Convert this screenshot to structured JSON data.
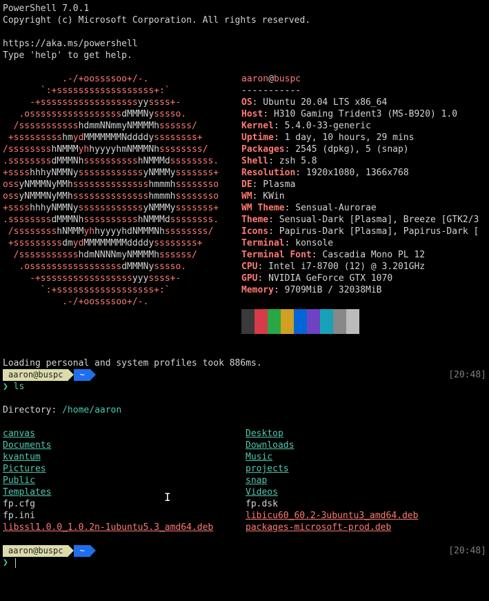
{
  "header": {
    "line1": "PowerShell 7.0.1",
    "line2": "Copyright (c) Microsoft Corporation. All rights reserved.",
    "link": "https://aka.ms/powershell",
    "help": "Type 'help' to get help."
  },
  "neo": {
    "user": "aaron",
    "at": "@",
    "host": "buspc",
    "sep": "-----------",
    "info": [
      {
        "k": "OS",
        "v": ": Ubuntu 20.04 LTS x86_64"
      },
      {
        "k": "Host",
        "v": ": H310 Gaming Trident3 (MS-B920) 1.0"
      },
      {
        "k": "Kernel",
        "v": ": 5.4.0-33-generic"
      },
      {
        "k": "Uptime",
        "v": ": 1 day, 10 hours, 29 mins"
      },
      {
        "k": "Packages",
        "v": ": 2545 (dpkg), 5 (snap)"
      },
      {
        "k": "Shell",
        "v": ": zsh 5.8"
      },
      {
        "k": "Resolution",
        "v": ": 1920x1080, 1366x768"
      },
      {
        "k": "DE",
        "v": ": Plasma"
      },
      {
        "k": "WM",
        "v": ": KWin"
      },
      {
        "k": "WM Theme",
        "v": ": Sensual-Aurorae"
      },
      {
        "k": "Theme",
        "v": ": Sensual-Dark [Plasma], Breeze [GTK2/3"
      },
      {
        "k": "Icons",
        "v": ": Papirus-Dark [Plasma], Papirus-Dark ["
      },
      {
        "k": "Terminal",
        "v": ": konsole"
      },
      {
        "k": "Terminal Font",
        "v": ": Cascadia Mono PL 12"
      },
      {
        "k": "CPU",
        "v": ": Intel i7-8700 (12) @ 3.201GHz"
      },
      {
        "k": "GPU",
        "v": ": NVIDIA GeForce GTX 1070"
      },
      {
        "k": "Memory",
        "v": ": 9709MiB / 32038MiB"
      }
    ]
  },
  "loading": "Loading personal and system profiles took 886ms.",
  "prompt": {
    "userhost": "aaron@buspc",
    "path": "~",
    "time1": "[20:48]",
    "time2": "[20:48]",
    "sym": "❯",
    "cmd": "ls"
  },
  "dir_line": {
    "label": "    Directory",
    "sep": ": ",
    "path": "/home/aaron"
  },
  "ls": {
    "col1": [
      {
        "t": "canvas",
        "c": "dir"
      },
      {
        "t": "Documents",
        "c": "dir"
      },
      {
        "t": "kvantum",
        "c": "dir"
      },
      {
        "t": "Pictures",
        "c": "dir"
      },
      {
        "t": "Public",
        "c": "dir"
      },
      {
        "t": "Templates",
        "c": "dir"
      },
      {
        "t": "fp.cfg",
        "c": "file"
      },
      {
        "t": "fp.ini",
        "c": "file"
      },
      {
        "t": "libssl1.0.0_1.0.2n-1ubuntu5.3_amd64.deb",
        "c": "deb"
      }
    ],
    "col2": [
      {
        "t": "Desktop",
        "c": "dir"
      },
      {
        "t": "Downloads",
        "c": "dir"
      },
      {
        "t": "Music",
        "c": "dir"
      },
      {
        "t": "projects",
        "c": "dir"
      },
      {
        "t": "snap",
        "c": "dir"
      },
      {
        "t": "Videos",
        "c": "dir"
      },
      {
        "t": "fp.dsk",
        "c": "file"
      },
      {
        "t": "libicu60_60.2-3ubuntu3_amd64.deb",
        "c": "deb"
      },
      {
        "t": "packages-microsoft-prod.deb",
        "c": "deb"
      }
    ]
  },
  "palette": [
    "#3a3a3a",
    "#d73a49",
    "#28a745",
    "#d0a020",
    "#0366d6",
    "#6f42c1",
    "#17a2b8",
    "#888888"
  ]
}
